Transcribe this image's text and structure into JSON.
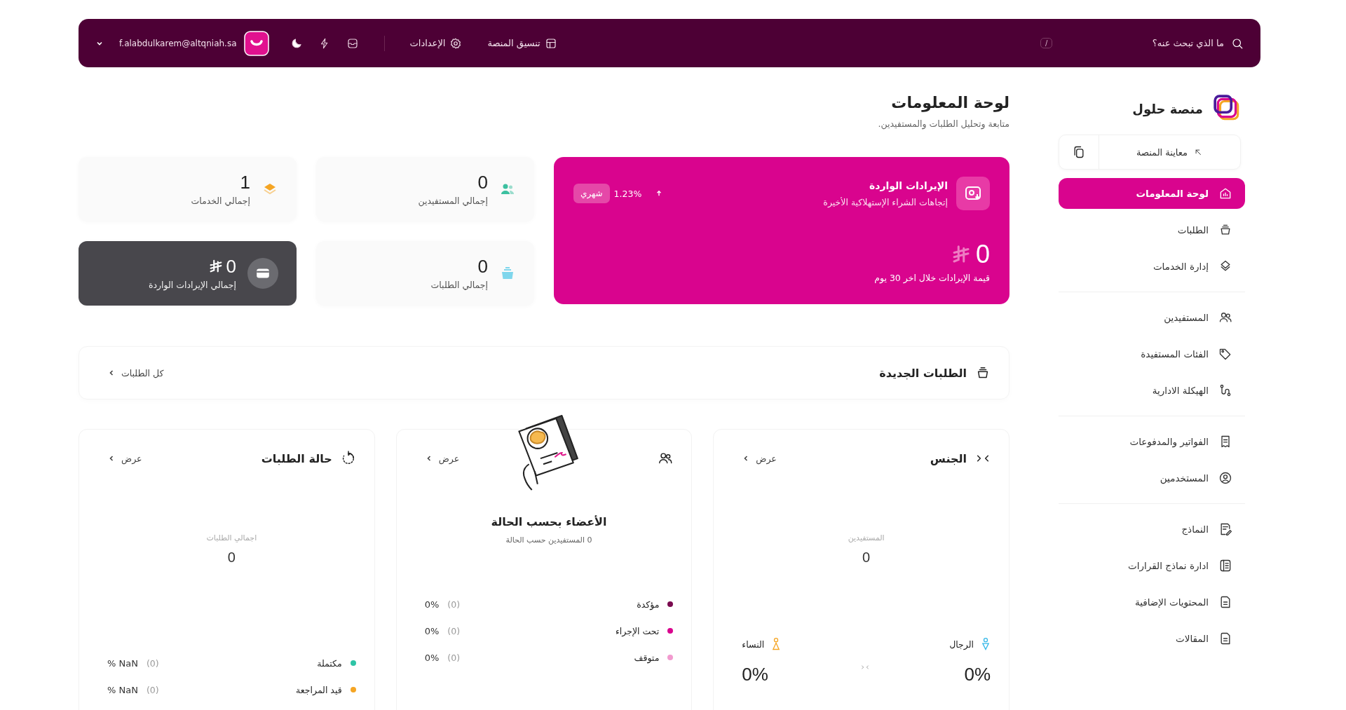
{
  "topbar": {
    "search_placeholder": "ما الذي تبحث عنه؟",
    "shortcut": "/",
    "links": [
      "تنسيق المنصة",
      "الإعدادات"
    ],
    "email": "f.alabdulkarem@altqniah.sa"
  },
  "sidebar": {
    "brand": "منصة حلول",
    "preview_button": "معاينة المنصة",
    "groups": [
      [
        {
          "label": "لوحة المعلومات",
          "selected": true
        },
        {
          "label": "الطلبات",
          "selected": false
        },
        {
          "label": "إدارة الخدمات",
          "selected": false
        }
      ],
      [
        {
          "label": "المستفيدين",
          "selected": false
        },
        {
          "label": "الفئات المستفيدة",
          "selected": false
        },
        {
          "label": "الهيكلة الادارية",
          "selected": false
        }
      ],
      [
        {
          "label": "الفواتير والمدفوعات",
          "selected": false
        },
        {
          "label": "المستخدمين",
          "selected": false
        }
      ],
      [
        {
          "label": "النماذج",
          "selected": false
        },
        {
          "label": "ادارة نماذج القرارات",
          "selected": false
        },
        {
          "label": "المحتويات الإضافية",
          "selected": false
        },
        {
          "label": "المقالات",
          "selected": false
        }
      ]
    ]
  },
  "page": {
    "title": "لوحة المعلومات",
    "subtitle": "متابعة وتحليل الطلبات والمستفيدين."
  },
  "revenue_card": {
    "title": "الإيرادات الواردة",
    "subtitle": "إتجاهات الشراء الإستهلاكية الأخيرة",
    "change": "1.23%",
    "period": "شهري",
    "value": "0",
    "caption": "قيمة الإيرادات خلال اخر 30 يوم"
  },
  "stats": [
    {
      "kind": "light",
      "value": "0",
      "label": "إجمالي المستفيدين",
      "color": "#3cc0a0"
    },
    {
      "kind": "light",
      "value": "1",
      "label": "إجمالي الخدمات",
      "color": "#f5a524"
    },
    {
      "kind": "light",
      "value": "0",
      "label": "إجمالي الطلبات",
      "color": "#7fd6ec"
    },
    {
      "kind": "dark",
      "value": "0",
      "label": "إجمالي الإيرادات الواردة",
      "color": "#6b6b70"
    }
  ],
  "new_orders": {
    "title": "الطلبات الجديدة",
    "link": "كل الطلبات"
  },
  "gender_card": {
    "title": "الجنس",
    "link": "عرض",
    "center_label": "المستفيدين",
    "center_value": "0",
    "men": {
      "label": "الرجال",
      "value": "0%"
    },
    "women": {
      "label": "النساء",
      "value": "0%"
    }
  },
  "members_card": {
    "title": "الأعضاء بحسب الحالة",
    "subtitle": "0 المستفيدين حسب الحالة",
    "link": "عرض",
    "legend": [
      {
        "label": "مؤكدة",
        "color": "#7a0b4f",
        "count": "(0)",
        "percent": "0%"
      },
      {
        "label": "تحت الإجراء",
        "color": "#d9048e",
        "count": "(0)",
        "percent": "0%"
      },
      {
        "label": "متوقف",
        "color": "#f29bcf",
        "count": "(0)",
        "percent": "0%"
      }
    ]
  },
  "status_card": {
    "title": "حالة الطلبات",
    "link": "عرض",
    "center_label": "اجمالي الطلبات",
    "center_value": "0",
    "legend": [
      {
        "label": "مكتملة",
        "color": "#2ec4a6",
        "count": "(0)",
        "percent": "% NaN"
      },
      {
        "label": "قيد المراجعة",
        "color": "#f5a524",
        "count": "(0)",
        "percent": "% NaN"
      }
    ]
  }
}
